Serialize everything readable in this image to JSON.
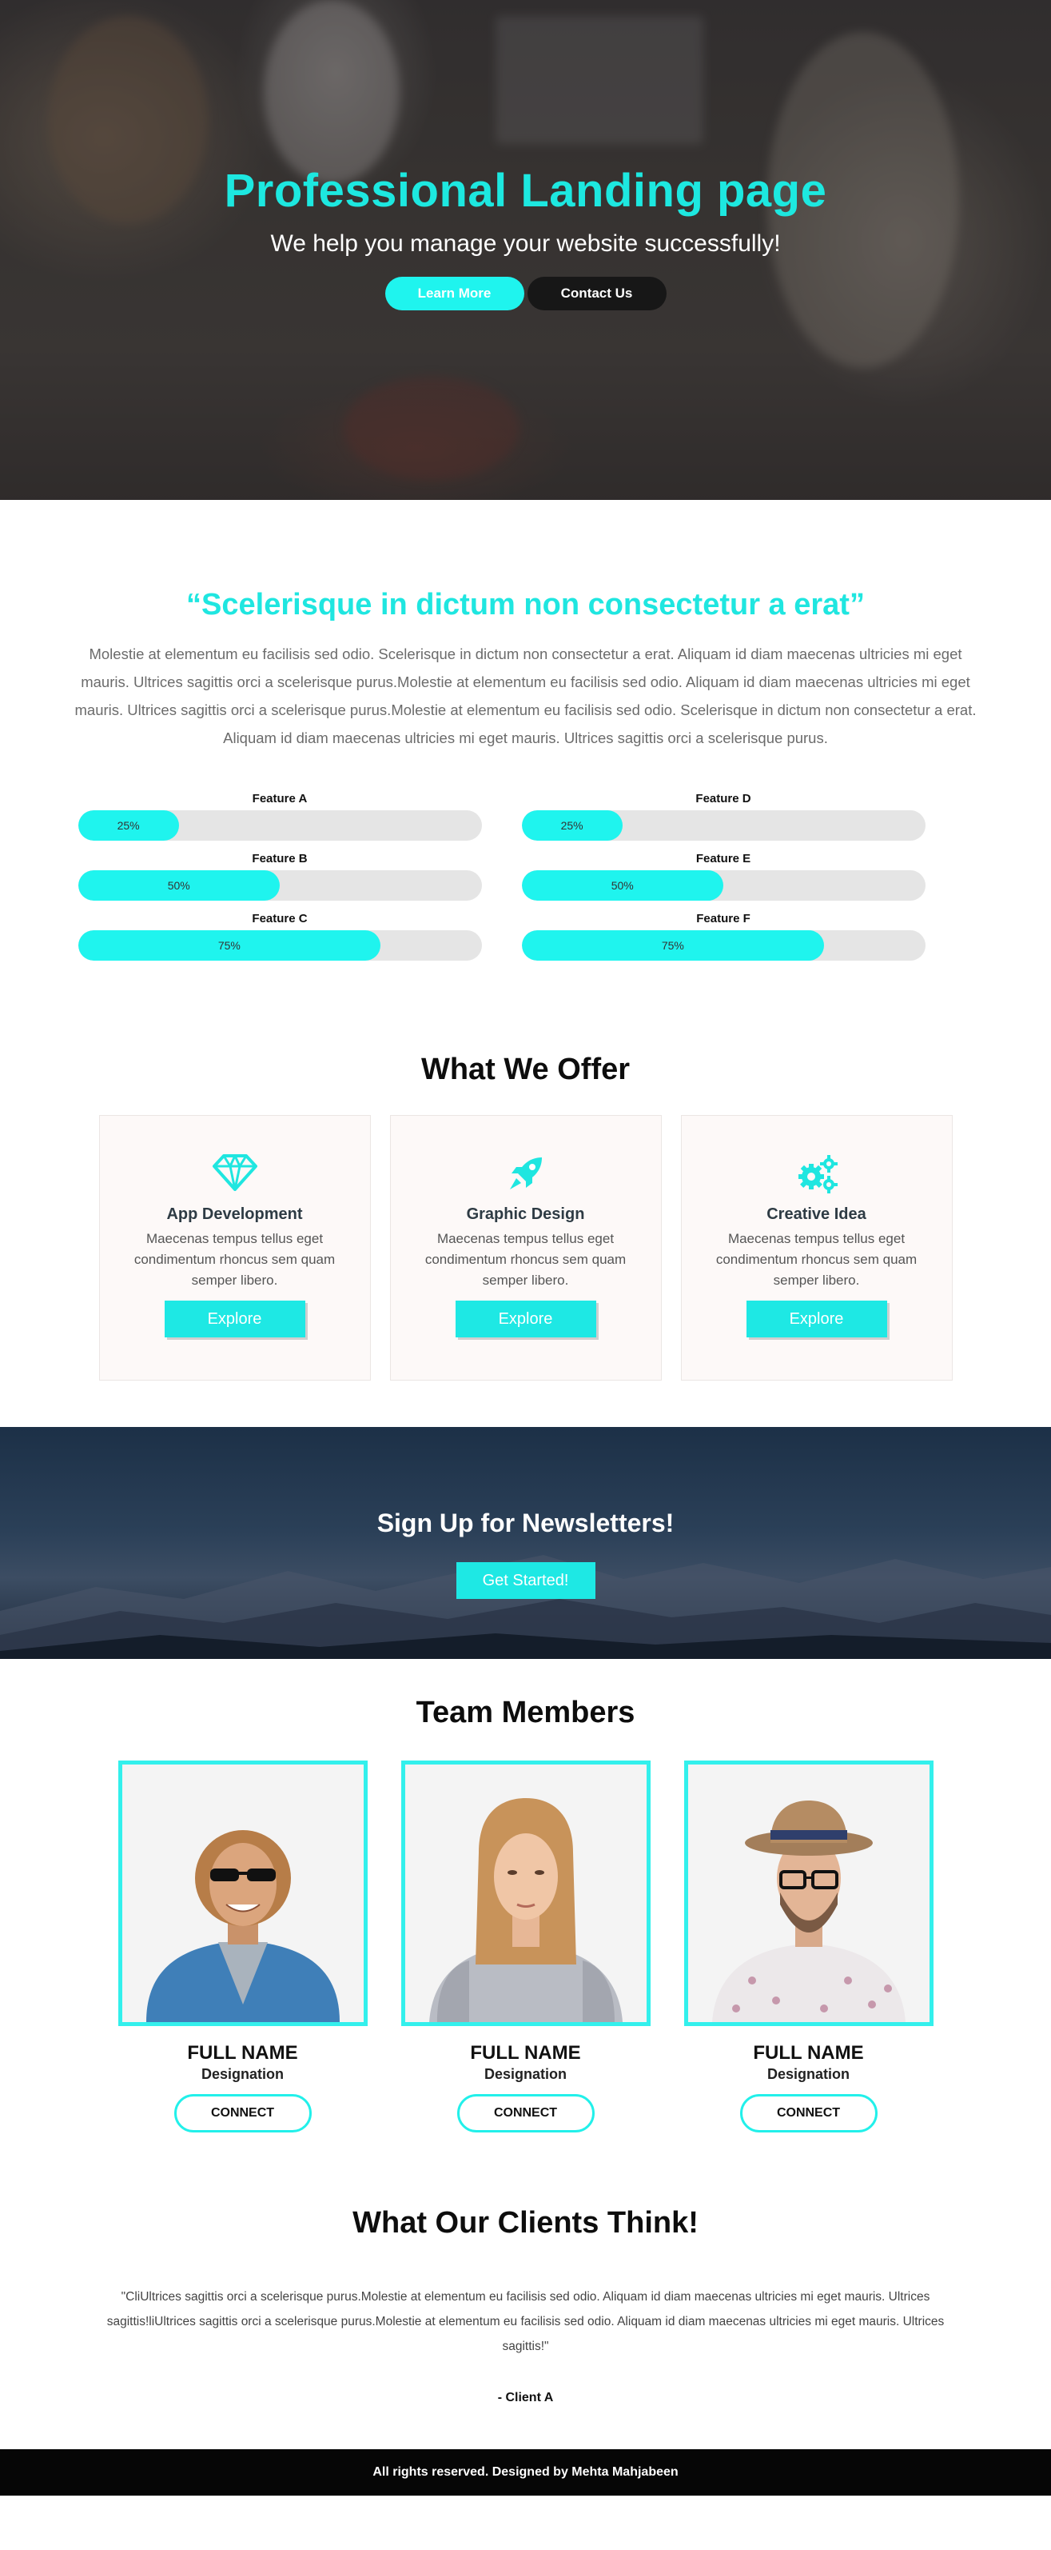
{
  "hero": {
    "title": "Professional Landing page",
    "subtitle": "We help you manage your website successfully!",
    "primary_button": "Learn More",
    "secondary_button": "Contact Us"
  },
  "quote": {
    "title": "“Scelerisque in dictum non consectetur a erat”",
    "body": "Molestie at elementum eu facilisis sed odio. Scelerisque in dictum non consectetur a erat. Aliquam id diam maecenas ultricies mi eget mauris. Ultrices sagittis orci a scelerisque purus.Molestie at elementum eu facilisis sed odio. Aliquam id diam maecenas ultricies mi eget mauris. Ultrices sagittis orci a scelerisque purus.Molestie at elementum eu facilisis sed odio. Scelerisque in dictum non consectetur a erat. Aliquam id diam maecenas ultricies mi eget mauris. Ultrices sagittis orci a scelerisque purus."
  },
  "features": [
    {
      "label": "Feature A",
      "value": 25,
      "text": "25%"
    },
    {
      "label": "Feature D",
      "value": 25,
      "text": "25%"
    },
    {
      "label": "Feature B",
      "value": 50,
      "text": "50%"
    },
    {
      "label": "Feature E",
      "value": 50,
      "text": "50%"
    },
    {
      "label": "Feature C",
      "value": 75,
      "text": "75%"
    },
    {
      "label": "Feature F",
      "value": 75,
      "text": "75%"
    }
  ],
  "offer": {
    "title": "What We Offer",
    "cards": [
      {
        "icon": "diamond-icon",
        "title": "App Development",
        "text": "Maecenas tempus tellus eget condimentum rhoncus sem quam semper libero.",
        "button": "Explore"
      },
      {
        "icon": "rocket-icon",
        "title": "Graphic Design",
        "text": "Maecenas tempus tellus eget condimentum rhoncus sem quam semper libero.",
        "button": "Explore"
      },
      {
        "icon": "gears-icon",
        "title": "Creative Idea",
        "text": "Maecenas tempus tellus eget condimentum rhoncus sem quam semper libero.",
        "button": "Explore"
      }
    ]
  },
  "newsletter": {
    "title": "Sign Up for Newsletters!",
    "button": "Get Started!"
  },
  "team": {
    "title": "Team Members",
    "members": [
      {
        "name": "FULL NAME",
        "role": "Designation",
        "button": "CONNECT"
      },
      {
        "name": "FULL NAME",
        "role": "Designation",
        "button": "CONNECT"
      },
      {
        "name": "FULL NAME",
        "role": "Designation",
        "button": "CONNECT"
      }
    ]
  },
  "clients": {
    "title": "What Our Clients Think!",
    "quote": "\"CliUltrices sagittis orci a scelerisque purus.Molestie at elementum eu facilisis sed odio. Aliquam id diam maecenas ultricies mi eget mauris. Ultrices sagittis!liUltrices sagittis orci a scelerisque purus.Molestie at elementum eu facilisis sed odio. Aliquam id diam maecenas ultricies mi eget mauris. Ultrices sagittis!\"",
    "author": "- Client A"
  },
  "footer": {
    "text": "All rights reserved. Designed by Mehta Mahjabeen"
  },
  "colors": {
    "accent": "#1ff4ee",
    "dark_button": "#171717",
    "footer": "#060606",
    "newsletter_bg": "#2b4058"
  }
}
